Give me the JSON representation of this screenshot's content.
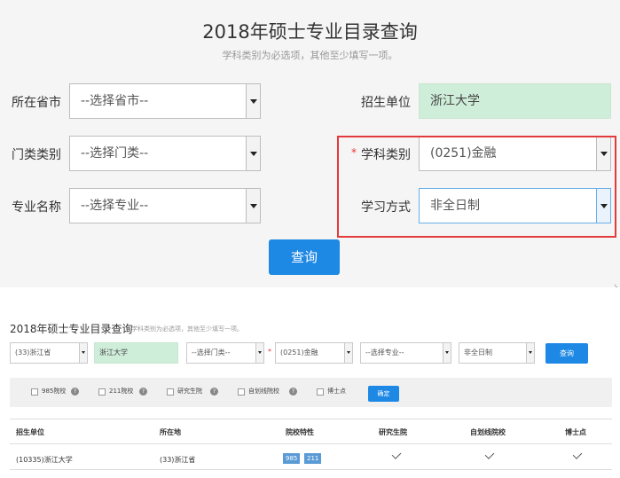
{
  "top": {
    "title": "2018年硕士专业目录查询",
    "subtitle": "学科类别为必选项，其他至少填写一项。",
    "labels": {
      "province": "所在省市",
      "unit": "招生单位",
      "category": "门类类别",
      "discipline": "学科类别",
      "major": "专业名称",
      "study_mode": "学习方式"
    },
    "values": {
      "province": "--选择省市--",
      "unit": "浙江大学",
      "category": "--选择门类--",
      "discipline": "(0251)金融",
      "major": "--选择专业--",
      "study_mode": "非全日制"
    },
    "required_mark": "*",
    "query_button": "查询"
  },
  "bottom": {
    "title": "2018年硕士专业目录查询",
    "subtitle": "学科类别为必选项，其他至少填写一项。",
    "fields": {
      "province": "(33)浙江省",
      "unit": "浙江大学",
      "category": "--选择门类--",
      "discipline": "(0251)金融",
      "major": "--选择专业--",
      "study_mode": "非全日制"
    },
    "required_mark": "*",
    "query_button": "查询",
    "filters": [
      "985院校",
      "211院校",
      "研究生院",
      "自划线院校",
      "博士点"
    ],
    "confirm_button": "确定",
    "table": {
      "headers": [
        "招生单位",
        "所在地",
        "院校特性",
        "研究生院",
        "自划线院校",
        "博士点"
      ],
      "row": {
        "unit": "(10335)浙江大学",
        "location": "(33)浙江省",
        "tags": [
          "985",
          "211"
        ]
      }
    }
  }
}
